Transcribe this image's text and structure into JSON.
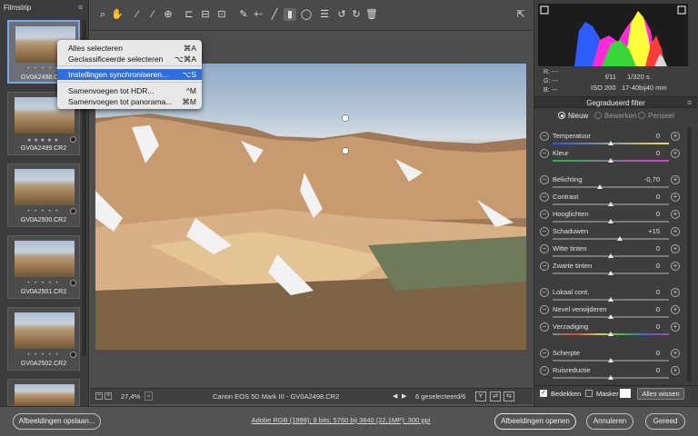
{
  "filmstrip": {
    "title": "Filmstrip",
    "menu_icon": "hamburger-icon",
    "items": [
      {
        "filename": "GV0A2498.CR2",
        "rating": "• • • • •",
        "selected": true,
        "has_badge": false
      },
      {
        "filename": "GV0A2499.CR2",
        "rating": "★★★★★",
        "selected": false,
        "has_badge": true
      },
      {
        "filename": "GV0A2500.CR2",
        "rating": "• • • • •",
        "selected": false,
        "has_badge": true
      },
      {
        "filename": "GV0A2501.CR2",
        "rating": "• • • • •",
        "selected": false,
        "has_badge": true
      },
      {
        "filename": "GV0A2502.CR2",
        "rating": "• • • • •",
        "selected": false,
        "has_badge": true
      }
    ]
  },
  "context_menu": {
    "items": [
      {
        "label": "Alles selecteren",
        "shortcut": "⌘A",
        "highlighted": false
      },
      {
        "label": "Geclassificeerde selecteren",
        "shortcut": "⌥⌘A",
        "highlighted": false
      },
      {
        "label": "Instellingen synchroniseren...",
        "shortcut": "⌥S",
        "highlighted": true
      },
      {
        "label": "Samenvoegen tot HDR...",
        "shortcut": "^M",
        "highlighted": false
      },
      {
        "label": "Samenvoegen tot panorama...",
        "shortcut": "⌘M",
        "highlighted": false
      }
    ]
  },
  "toolbar": {
    "tools": [
      "zoom-icon",
      "hand-icon",
      "white-balance-icon",
      "color-sampler-icon",
      "targeted-adjustment-icon",
      "crop-icon",
      "straighten-icon",
      "transform-icon",
      "spot-removal-icon",
      "red-eye-icon",
      "adjustment-brush-icon",
      "graduated-filter-icon",
      "radial-filter-icon",
      "preferences-icon",
      "rotate-left-icon",
      "rotate-right-icon",
      "trash-icon"
    ],
    "active_tool": "graduated-filter-icon",
    "fullscreen_icon": "fullscreen-icon"
  },
  "status": {
    "zoom": "27,4%",
    "camera": "Canon EOS 5D Mark III",
    "separator": "-",
    "filename": "GV0A2498.CR2",
    "selection": "6 geselecteerd/6",
    "toggle_y": "Y"
  },
  "info": {
    "r_label": "R:",
    "g_label": "G:",
    "b_label": "B:",
    "r_value": "---",
    "g_value": "---",
    "b_value": "---",
    "aperture": "f/11",
    "shutter": "1/320 s",
    "iso": "ISO 200",
    "lens": "17-40bij40 mm"
  },
  "panel": {
    "title": "Gegradueerd filter",
    "modes": [
      "Nieuw",
      "Bewerken",
      "Penseel"
    ],
    "selected_mode": "Nieuw",
    "sliders": [
      {
        "label": "Temperatuur",
        "value": "0",
        "pos": 0.5,
        "colored": "temp"
      },
      {
        "label": "Kleur",
        "value": "0",
        "pos": 0.5,
        "colored": "tint"
      },
      {
        "label": "Belichting",
        "value": "-0,70",
        "pos": 0.41,
        "colored": ""
      },
      {
        "label": "Contrast",
        "value": "0",
        "pos": 0.5,
        "colored": ""
      },
      {
        "label": "Hooglichten",
        "value": "0",
        "pos": 0.5,
        "colored": ""
      },
      {
        "label": "Schaduwen",
        "value": "+15",
        "pos": 0.58,
        "colored": ""
      },
      {
        "label": "Witte tinten",
        "value": "0",
        "pos": 0.5,
        "colored": ""
      },
      {
        "label": "Zwarte tinten",
        "value": "0",
        "pos": 0.5,
        "colored": ""
      },
      {
        "label": "Lokaal cont.",
        "value": "0",
        "pos": 0.5,
        "colored": ""
      },
      {
        "label": "Nevel verwijderen",
        "value": "0",
        "pos": 0.5,
        "colored": ""
      },
      {
        "label": "Verzadiging",
        "value": "0",
        "pos": 0.5,
        "colored": "sat"
      },
      {
        "label": "Scherpte",
        "value": "0",
        "pos": 0.5,
        "colored": ""
      },
      {
        "label": "Ruisreductie",
        "value": "0",
        "pos": 0.5,
        "colored": ""
      }
    ],
    "footer": {
      "overlay_label": "Bedekken",
      "overlay_checked": true,
      "mask_label": "Masker",
      "mask_checked": false,
      "clear_all": "Alles wissen"
    }
  },
  "bottom": {
    "save_label": "Afbeeldingen opslaan...",
    "workflow_link": "Adobe RGB (1998); 8 bits; 5760 bij 3840 (22,1MP); 300 ppi",
    "open_label": "Afbeeldingen openen",
    "cancel_label": "Annuleren",
    "done_label": "Gereed"
  },
  "colors": {
    "accent": "#2d6fe0",
    "selection_border": "#7aa7e8"
  }
}
